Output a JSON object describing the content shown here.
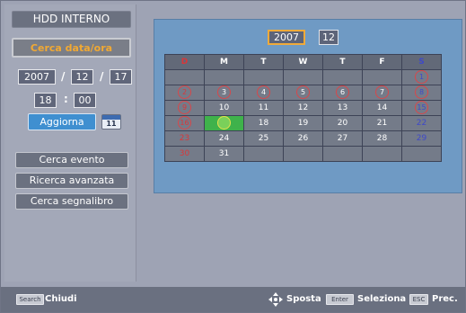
{
  "left_panel": {
    "hdd_label": "HDD INTERNO",
    "search_date_label": "Cerca data/ora",
    "date": {
      "year": "2007",
      "month": "12",
      "day": "17",
      "sep": "/"
    },
    "time": {
      "hour": "18",
      "minute": "00",
      "sep": ":"
    },
    "update_label": "Aggiorna",
    "calendar_icon_text": "11",
    "menu": [
      {
        "label": "Cerca evento"
      },
      {
        "label": "Ricerca avanzata"
      },
      {
        "label": "Cerca segnalibro"
      }
    ]
  },
  "calendar": {
    "year": "2007",
    "month": "12",
    "weekdays": [
      "D",
      "M",
      "T",
      "W",
      "T",
      "F",
      "S"
    ],
    "weeks": [
      [
        "",
        "",
        "",
        "",
        "",
        "",
        "1"
      ],
      [
        "2",
        "3",
        "4",
        "5",
        "6",
        "7",
        "8"
      ],
      [
        "9",
        "10",
        "11",
        "12",
        "13",
        "14",
        "15"
      ],
      [
        "16",
        "17",
        "18",
        "19",
        "20",
        "21",
        "22"
      ],
      [
        "23",
        "24",
        "25",
        "26",
        "27",
        "28",
        "29"
      ],
      [
        "30",
        "31",
        "",
        "",
        "",
        "",
        ""
      ]
    ],
    "circled_days": [
      "1",
      "2",
      "3",
      "4",
      "5",
      "6",
      "7",
      "8",
      "9",
      "15",
      "16",
      "17"
    ],
    "selected_day": "17",
    "colors": {
      "sunday": "#d9373a",
      "saturday": "#3f49c8",
      "selected": "#3fb24b",
      "highlight": "#f0aa3a"
    }
  },
  "bottom_bar": {
    "search_key": "Search",
    "close_label": "Chiudi",
    "move_label": "Sposta",
    "enter_key": "Enter",
    "select_label": "Seleziona",
    "esc_key": "ESC",
    "back_label": "Prec."
  }
}
